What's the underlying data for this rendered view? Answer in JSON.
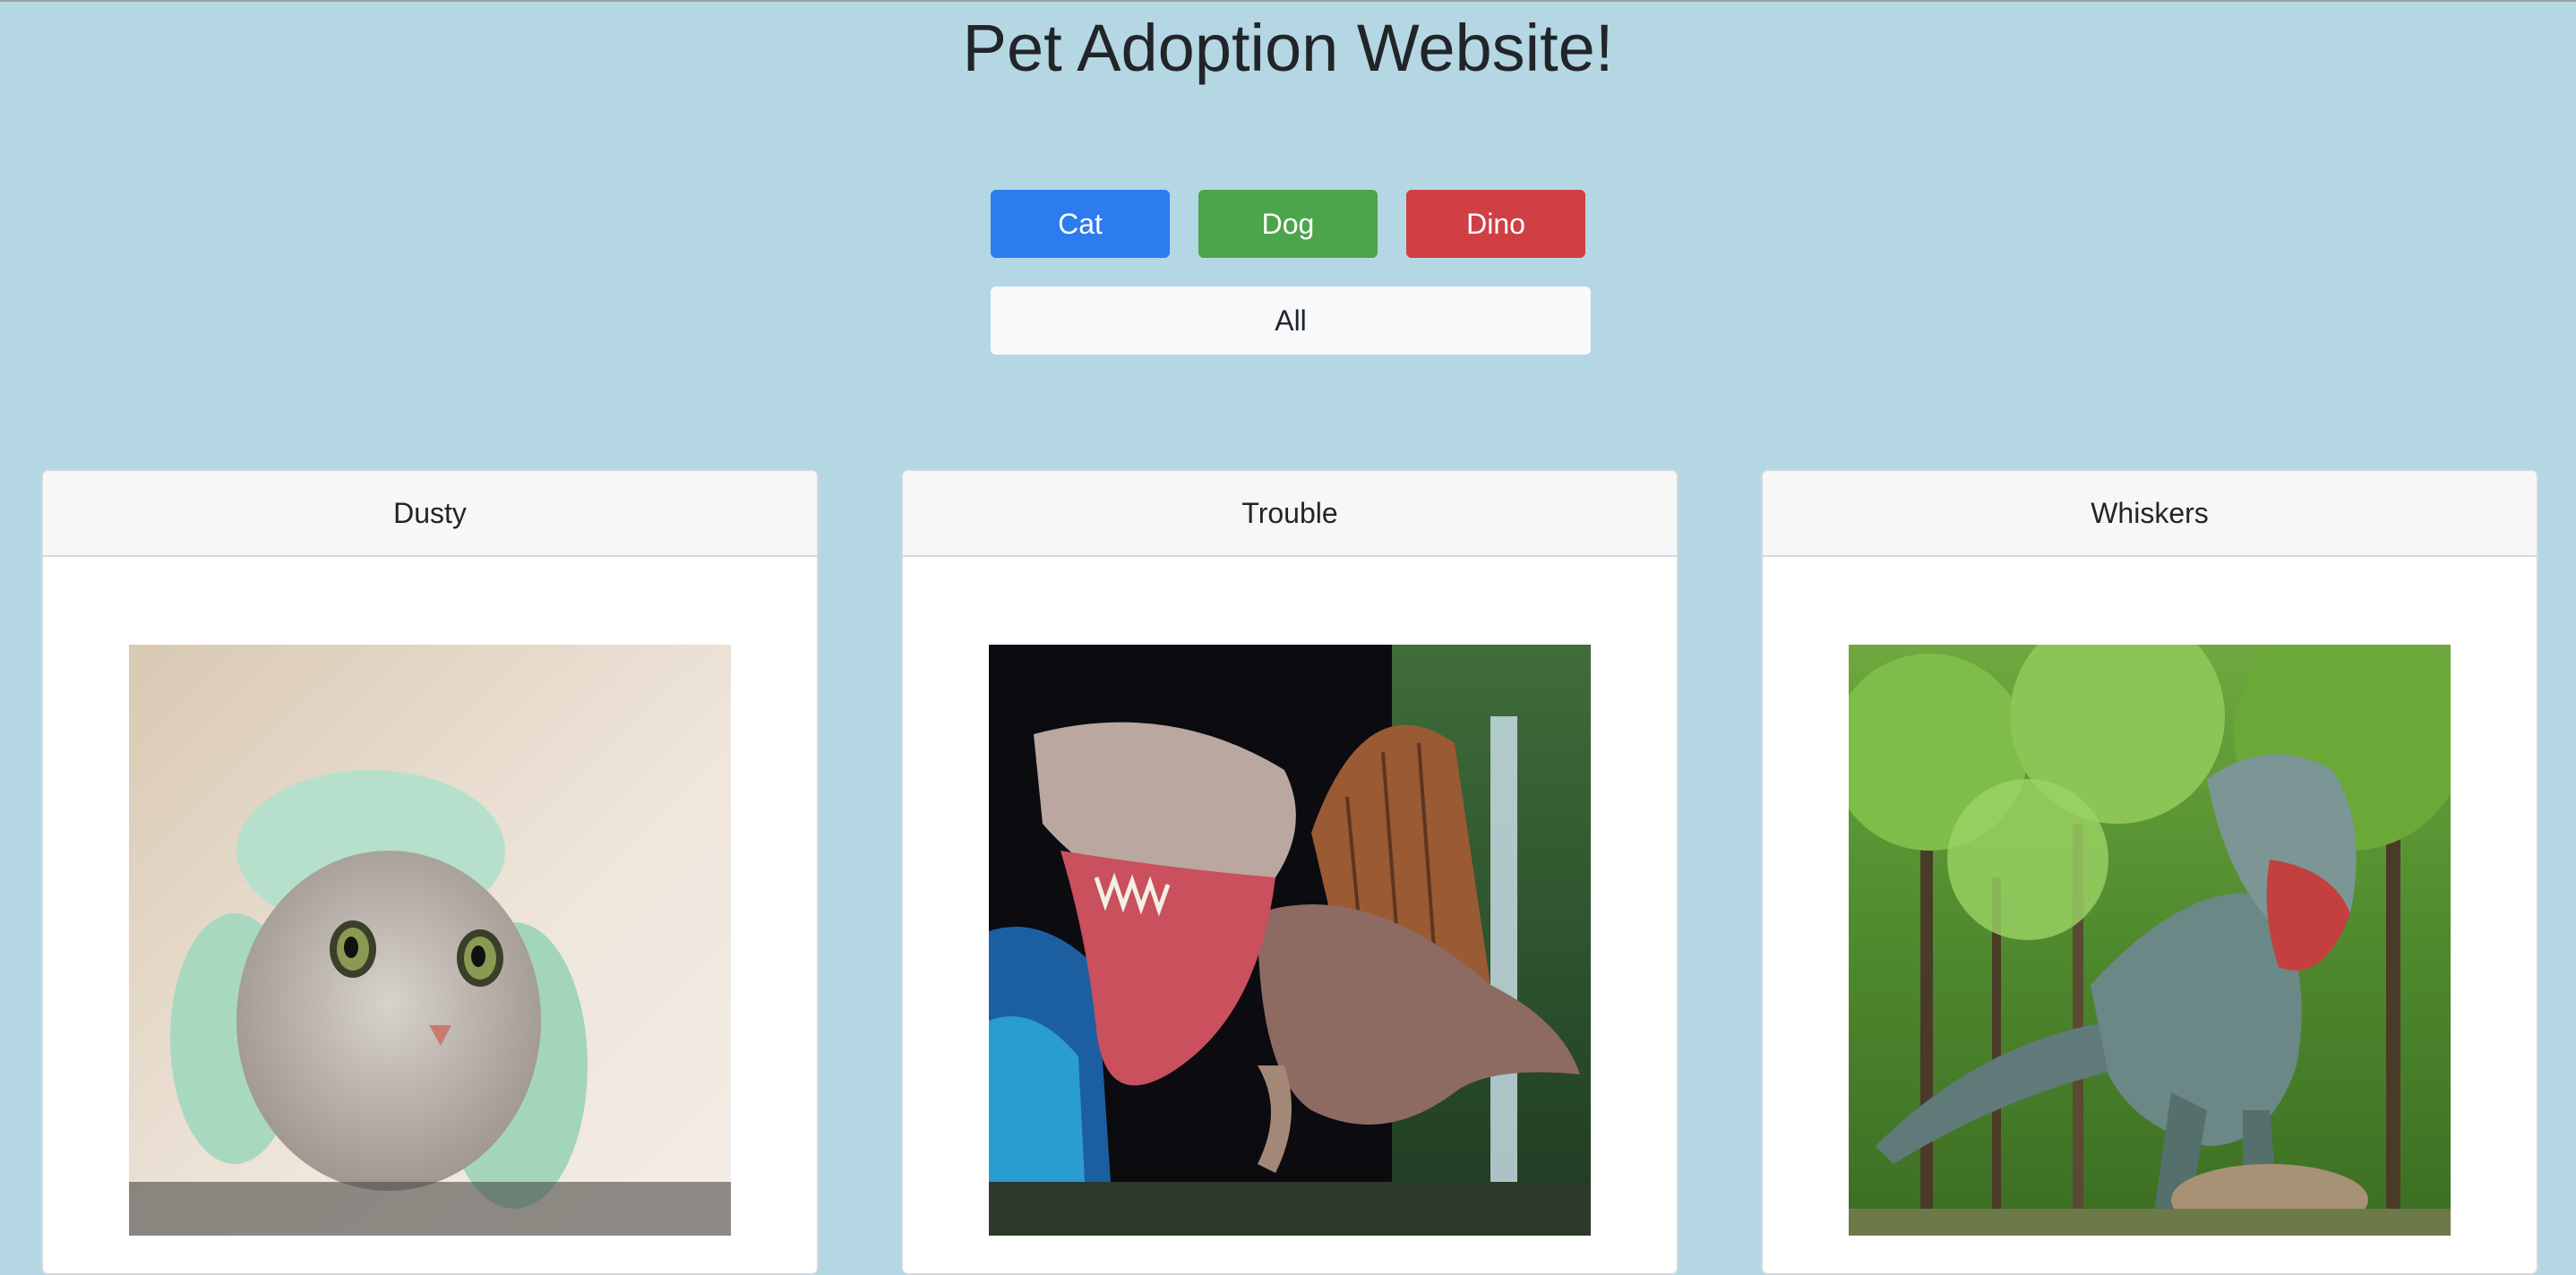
{
  "header": {
    "title": "Pet Adoption Website!"
  },
  "filters": {
    "cat_label": "Cat",
    "dog_label": "Dog",
    "dino_label": "Dino",
    "all_label": "All"
  },
  "pets": [
    {
      "name": "Dusty",
      "image": "cat-in-knitted-hat-photo"
    },
    {
      "name": "Trouble",
      "image": "spinosaurus-photo"
    },
    {
      "name": "Whiskers",
      "image": "t-rex-in-forest-photo"
    }
  ],
  "colors": {
    "background": "#b4d7e3",
    "cat_button": "#2c7bef",
    "dog_button": "#4ca54a",
    "dino_button": "#cf3f44",
    "all_button": "#f8f9fa"
  }
}
